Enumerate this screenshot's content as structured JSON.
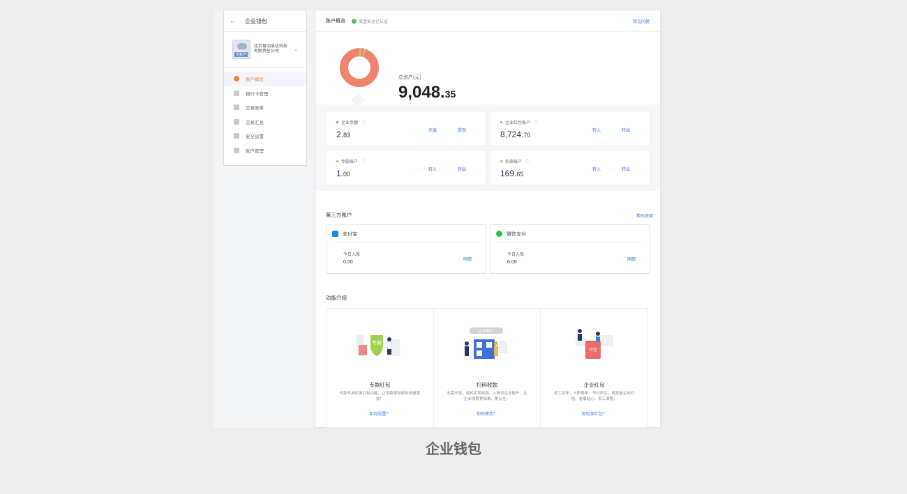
{
  "sidebar": {
    "title": "企业钱包",
    "company_name": "北京易动诺达科技有限责任公司",
    "logo_tag": "主账户",
    "items": [
      {
        "label": "账户概览"
      },
      {
        "label": "银行卡管理"
      },
      {
        "label": "交易账单"
      },
      {
        "label": "交易汇总"
      },
      {
        "label": "安全设置"
      },
      {
        "label": "账户管理"
      }
    ]
  },
  "header": {
    "title": "账户概览",
    "verified": "资金安全已认证",
    "faq": "常见问题"
  },
  "assets": {
    "label": "总资产(元)",
    "integer": "9,048.",
    "decimal": "35",
    "donut_colors": [
      "#f0836c",
      "#a8d46f",
      "#f6c36b"
    ]
  },
  "accounts": [
    {
      "name": "企业余额",
      "int": "2.",
      "dec": "83",
      "dot": "#4a90e2",
      "actions": [
        "充值",
        "提现"
      ]
    },
    {
      "name": "企业红包账户",
      "int": "8,724.",
      "dec": "70",
      "dot": "#f0836c",
      "actions": [
        "转入",
        "转出"
      ]
    },
    {
      "name": "专款账户",
      "int": "1.",
      "dec": "00",
      "dot": "#8bc34a",
      "actions": [
        "转入",
        "转出"
      ]
    },
    {
      "name": "外部账户",
      "int": "169.",
      "dec": "65",
      "dot": "#8bc34a",
      "actions": [
        "转入",
        "转出"
      ]
    }
  ],
  "third_party": {
    "title": "第三方账户",
    "help": "帮助说明",
    "cards": [
      {
        "name": "支付宝",
        "label": "今日入账",
        "amount": "0.00",
        "link": "明细",
        "color": "#1e88e5"
      },
      {
        "name": "微信支付",
        "label": "今日入账",
        "amount": "0.00",
        "link": "明细",
        "color": "#2ec24a"
      }
    ]
  },
  "features": {
    "title": "功能介绍",
    "cards": [
      {
        "title": "专款红包",
        "desc": "专款专用的发红包功能，让专款更有原则快速更加！",
        "link": "如何设置？",
        "badge": "专款"
      },
      {
        "title": "扫码收款",
        "desc": "无需开发，轻松实现收款，入账到企业账户，让企业收款更简单、更安全。",
        "link": "如何使用？",
        "badge": "企业账户"
      },
      {
        "title": "企业红包",
        "desc": "员工关怀，入职周年、节日庆生，或发放企业红包，省事贴心，员工满意。",
        "link": "如何发红包？",
        "badge": "红包"
      }
    ]
  },
  "caption": "企业钱包"
}
